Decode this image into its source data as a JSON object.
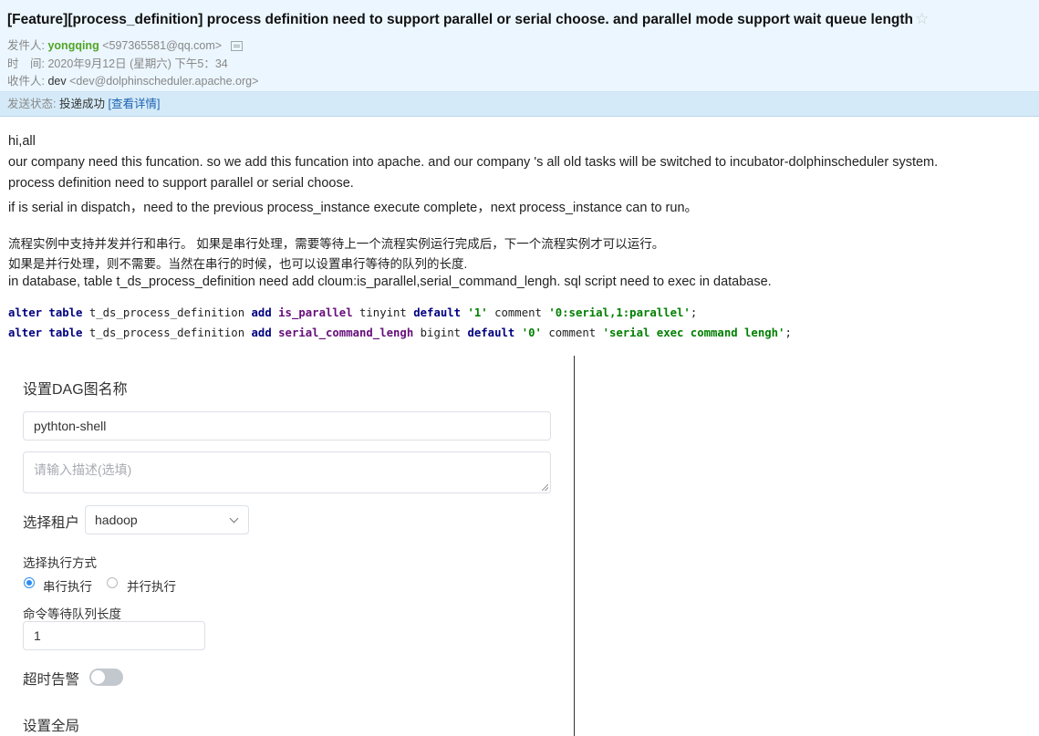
{
  "email": {
    "subject": "[Feature][process_definition] process definition need to support parallel or serial choose. and parallel mode support wait queue length",
    "star_icon": "☆",
    "sender_label": "发件人:",
    "sender_name": "yongqing",
    "sender_email": "<597365581@qq.com>",
    "time_label": "时　间:",
    "time_value": "2020年9月12日 (星期六) 下午5：34",
    "recipient_label": "收件人:",
    "recipient_name": "dev",
    "recipient_email": "<dev@dolphinscheduler.apache.org>",
    "status_label": "发送状态:",
    "status_value": "投递成功",
    "status_link": "[查看详情]"
  },
  "body": {
    "lines": [
      "hi,all",
      "our company need this funcation. so we add this funcation into apache. and our company 's all old tasks will be switched to incubator-dolphinscheduler system.",
      "process definition need to support parallel or serial choose.",
      "if is serial in dispatch，need to the previous process_instance execute complete，next process_instance can to run。"
    ],
    "cn_lines": [
      "流程实例中支持并发并行和串行。 如果是串行处理，需要等待上一个流程实例运行完成后，下一个流程实例才可以运行。",
      "如果是并行处理，则不需要。当然在串行的时候，也可以设置串行等待的队列的长度."
    ],
    "db_line": " in database, table t_ds_process_definition need add cloum:is_parallel,serial_command_lengh. sql script need to exec in database."
  },
  "code": {
    "line1": {
      "kw1": "alter table",
      "t1": " t_ds_process_definition ",
      "kw2": "add",
      "sp1": " ",
      "field": "is_parallel",
      "t2": " tinyint ",
      "kw3": "default",
      "sp2": " ",
      "s1": "'1'",
      "t3": " comment ",
      "s2": "'0:serial,1:parallel'",
      "end": ";"
    },
    "line2": {
      "kw1": "alter table",
      "t1": " t_ds_process_definition ",
      "kw2": "add",
      "sp1": " ",
      "field": "serial_command_lengh",
      "t2": " bigint ",
      "kw3": "default",
      "sp2": " ",
      "s1": "'0'",
      "t3": " comment ",
      "s2": "'serial exec command lengh'",
      "end": ";"
    }
  },
  "form": {
    "dag_title": "设置DAG图名称",
    "name_value": "pythton-shell",
    "desc_placeholder": "请输入描述(选填)",
    "tenant_label": "选择租户",
    "tenant_value": "hadoop",
    "exec_mode_label": "选择执行方式",
    "exec_serial": "串行执行",
    "exec_parallel": "并行执行",
    "queue_label": "命令等待队列长度",
    "queue_value": "1",
    "timeout_label": "超时告警",
    "global_label": "设置全局"
  },
  "colors": {
    "sender_name": "#51a526",
    "link": "#1b63b0",
    "radio_checked": "#2d8cf0"
  }
}
